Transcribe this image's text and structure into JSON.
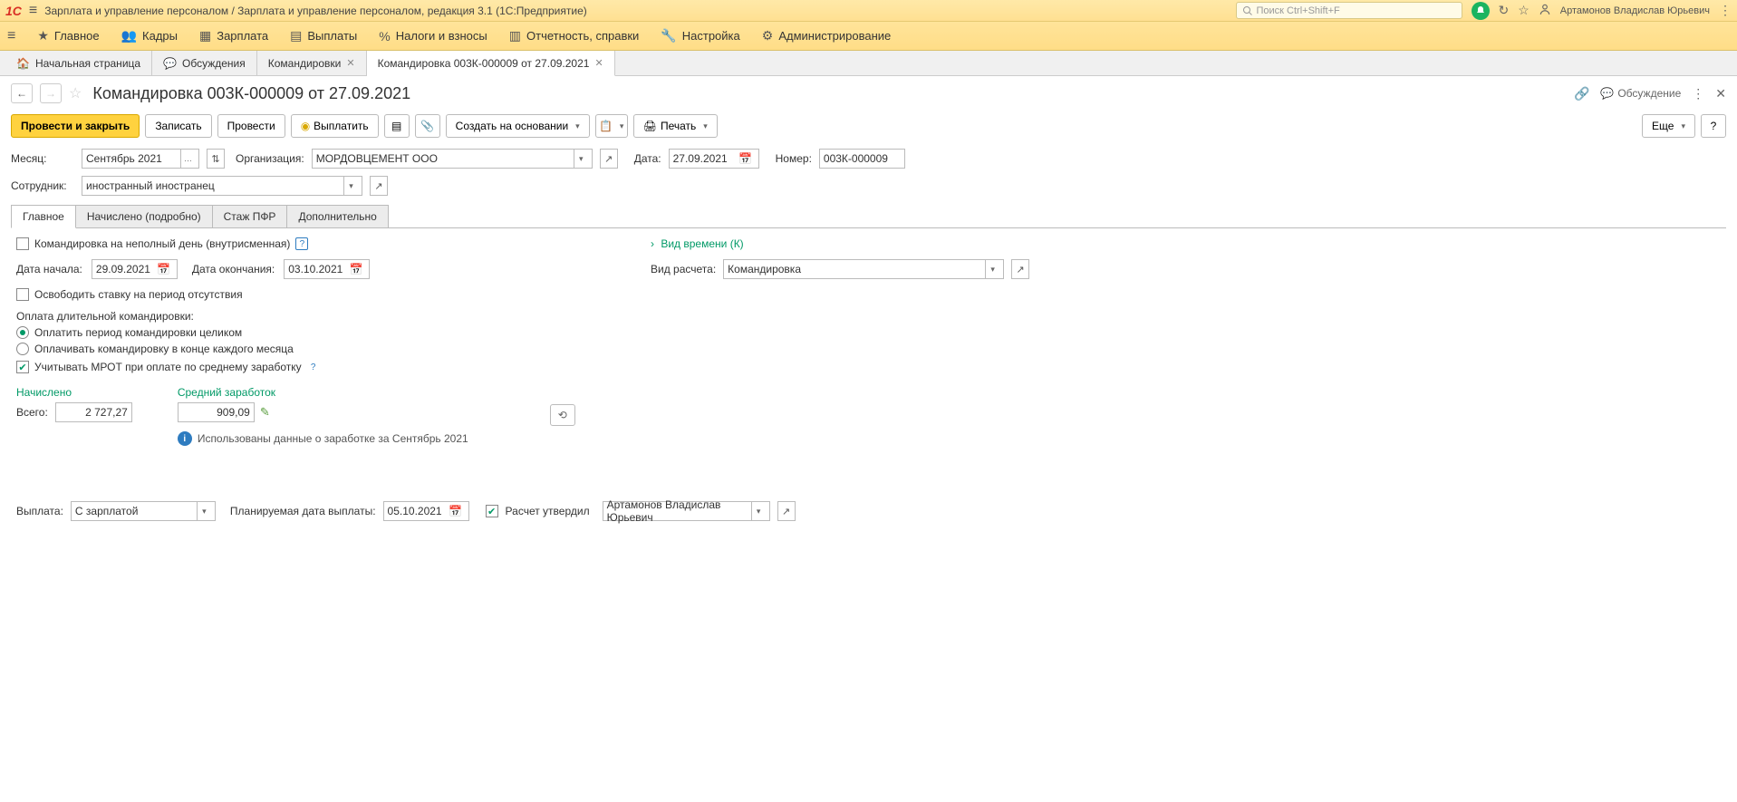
{
  "titlebar": {
    "title": "Зарплата и управление персоналом / Зарплата и управление персоналом, редакция 3.1  (1С:Предприятие)",
    "search_placeholder": "Поиск Ctrl+Shift+F",
    "user": "Артамонов Владислав Юрьевич"
  },
  "menubar": [
    {
      "icon": "star",
      "label": "Главное"
    },
    {
      "icon": "people",
      "label": "Кадры"
    },
    {
      "icon": "calc",
      "label": "Зарплата"
    },
    {
      "icon": "cash",
      "label": "Выплаты"
    },
    {
      "icon": "percent",
      "label": "Налоги и взносы"
    },
    {
      "icon": "doc",
      "label": "Отчетность, справки"
    },
    {
      "icon": "wrench",
      "label": "Настройка"
    },
    {
      "icon": "gear",
      "label": "Администрирование"
    }
  ],
  "tabs": [
    {
      "icon": "home",
      "label": "Начальная страница"
    },
    {
      "icon": "chat",
      "label": "Обсуждения"
    },
    {
      "icon": "",
      "label": "Командировки",
      "closable": true
    },
    {
      "icon": "",
      "label": "Командировка 003К-000009 от 27.09.2021",
      "closable": true,
      "active": true
    }
  ],
  "page": {
    "title": "Командировка 003К-000009 от 27.09.2021",
    "discussion": "Обсуждение"
  },
  "cmdbar": {
    "post_close": "Провести и закрыть",
    "write": "Записать",
    "post": "Провести",
    "pay": "Выплатить",
    "create_basis": "Создать на основании",
    "print": "Печать",
    "more": "Еще",
    "help": "?"
  },
  "fields": {
    "month_label": "Месяц:",
    "month_value": "Сентябрь 2021",
    "org_label": "Организация:",
    "org_value": "МОРДОВЦЕМЕНТ ООО",
    "date_label": "Дата:",
    "date_value": "27.09.2021",
    "number_label": "Номер:",
    "number_value": "003К-000009",
    "employee_label": "Сотрудник:",
    "employee_value": "иностранный иностранец"
  },
  "subtabs": [
    "Главное",
    "Начислено (подробно)",
    "Стаж ПФР",
    "Дополнительно"
  ],
  "main": {
    "partial_day": "Командировка на неполный день (внутрисменная)",
    "start_label": "Дата начала:",
    "start_value": "29.09.2021",
    "end_label": "Дата окончания:",
    "end_value": "03.10.2021",
    "free_rate": "Освободить ставку на период отсутствия",
    "long_payment_label": "Оплата длительной командировки:",
    "radio_whole": "Оплатить период командировки целиком",
    "radio_monthly": "Оплачивать командировку в конце каждого месяца",
    "mrot": "Учитывать МРОТ при оплате по среднему заработку",
    "accrued_label": "Начислено",
    "avg_label": "Средний заработок",
    "total_label": "Всего:",
    "total_value": "2 727,27",
    "avg_value": "909,09",
    "info_text": "Использованы данные о заработке за Сентябрь 2021",
    "time_type_link": "Вид времени (К)",
    "calc_type_label": "Вид расчета:",
    "calc_type_value": "Командировка"
  },
  "footer": {
    "payment_label": "Выплата:",
    "payment_value": "С зарплатой",
    "planned_date_label": "Планируемая дата выплаты:",
    "planned_date_value": "05.10.2021",
    "approved_label": "Расчет утвердил",
    "approved_by": "Артамонов Владислав Юрьевич"
  }
}
